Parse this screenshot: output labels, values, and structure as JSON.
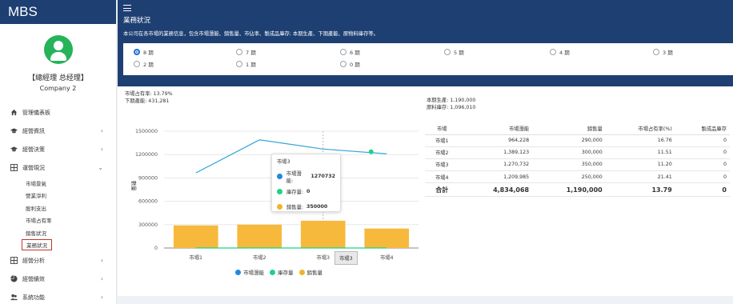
{
  "app": {
    "brand": "MBS"
  },
  "user": {
    "role": "【總經理 总经理】",
    "company": "Company 2"
  },
  "sidebar": {
    "items": [
      {
        "label": "管理儀表板",
        "icon": "home-icon",
        "chevron": ""
      },
      {
        "label": "經營資訊",
        "icon": "graduation-cap-icon",
        "chevron": "›"
      },
      {
        "label": "經營決策",
        "icon": "graduation-cap-icon",
        "chevron": "›"
      },
      {
        "label": "運營現況",
        "icon": "grid-icon",
        "chevron": "⌄"
      }
    ],
    "subitems": [
      "市場景氣",
      "營業淨利",
      "股利支出",
      "市場占有率",
      "銷售狀況",
      "業務狀況"
    ],
    "items_bottom": [
      {
        "label": "經營分析",
        "icon": "grid-icon",
        "chevron": "›"
      },
      {
        "label": "經營績效",
        "icon": "pie-chart-icon",
        "chevron": "›"
      },
      {
        "label": "系統功能",
        "icon": "users-icon",
        "chevron": "›"
      }
    ]
  },
  "header": {
    "title": "業務狀況",
    "description": "本公司在各市場的業務信息，包含市場潛能、銷售量、市佔率、製成品庫存; 本期生產、下期產能、原物料庫存等。"
  },
  "periods": {
    "options": [
      "8 期",
      "7 期",
      "6 期",
      "5 期",
      "4 期",
      "3 期",
      "2 期",
      "1 期",
      "0 期"
    ],
    "selected": "8 期"
  },
  "stats": {
    "market_share": "市場占有率: 13.79%",
    "next_capacity": "下期產能: 431,281",
    "this_production": "本期生產: 1,190,000",
    "raw_inventory": "原料庫存: 1,096,010"
  },
  "chart_data": {
    "type": "bar",
    "categories": [
      "市場1",
      "市場2",
      "市場3",
      "市場4"
    ],
    "ylabel": "數量",
    "ylim": [
      0,
      1500000
    ],
    "yticks": [
      0,
      300000,
      600000,
      900000,
      1200000,
      1500000
    ],
    "tick_labels": [
      "0",
      "300000",
      "600000",
      "900000",
      "1200000",
      "1500000"
    ],
    "series": [
      {
        "name": "市場潛能",
        "kind": "line",
        "color": "#35a7d9",
        "values": [
          964228,
          1389123,
          1270732,
          1209985
        ]
      },
      {
        "name": "庫存量",
        "kind": "line",
        "color": "#1dd28a",
        "values": [
          0,
          0,
          0,
          0
        ]
      },
      {
        "name": "銷售量",
        "kind": "bar",
        "color": "#f7b93b",
        "values": [
          290000,
          300000,
          350000,
          250000
        ]
      }
    ],
    "tooltip": {
      "title": "市場3",
      "rows": [
        {
          "label": "市場潛能:",
          "value": "1270732",
          "color": "#2189e0"
        },
        {
          "label": "庫存量:",
          "value": "0",
          "color": "#1dd28a"
        },
        {
          "label": "銷售量:",
          "value": "350000",
          "color": "#f0b429"
        }
      ]
    },
    "axis_pointer_label": "市場3"
  },
  "table": {
    "headers": [
      "市場",
      "市場潛能",
      "銷售量",
      "市場占有率(%)",
      "製成品庫存"
    ],
    "rows": [
      [
        "市場1",
        "964,228",
        "290,000",
        "16.76",
        "0"
      ],
      [
        "市場2",
        "1,389,123",
        "300,000",
        "11.51",
        "0"
      ],
      [
        "市場3",
        "1,270,732",
        "350,000",
        "11.20",
        "0"
      ],
      [
        "市場4",
        "1,209,985",
        "250,000",
        "21.41",
        "0"
      ]
    ],
    "total": [
      "合計",
      "4,834,068",
      "1,190,000",
      "13.79",
      "0"
    ]
  }
}
